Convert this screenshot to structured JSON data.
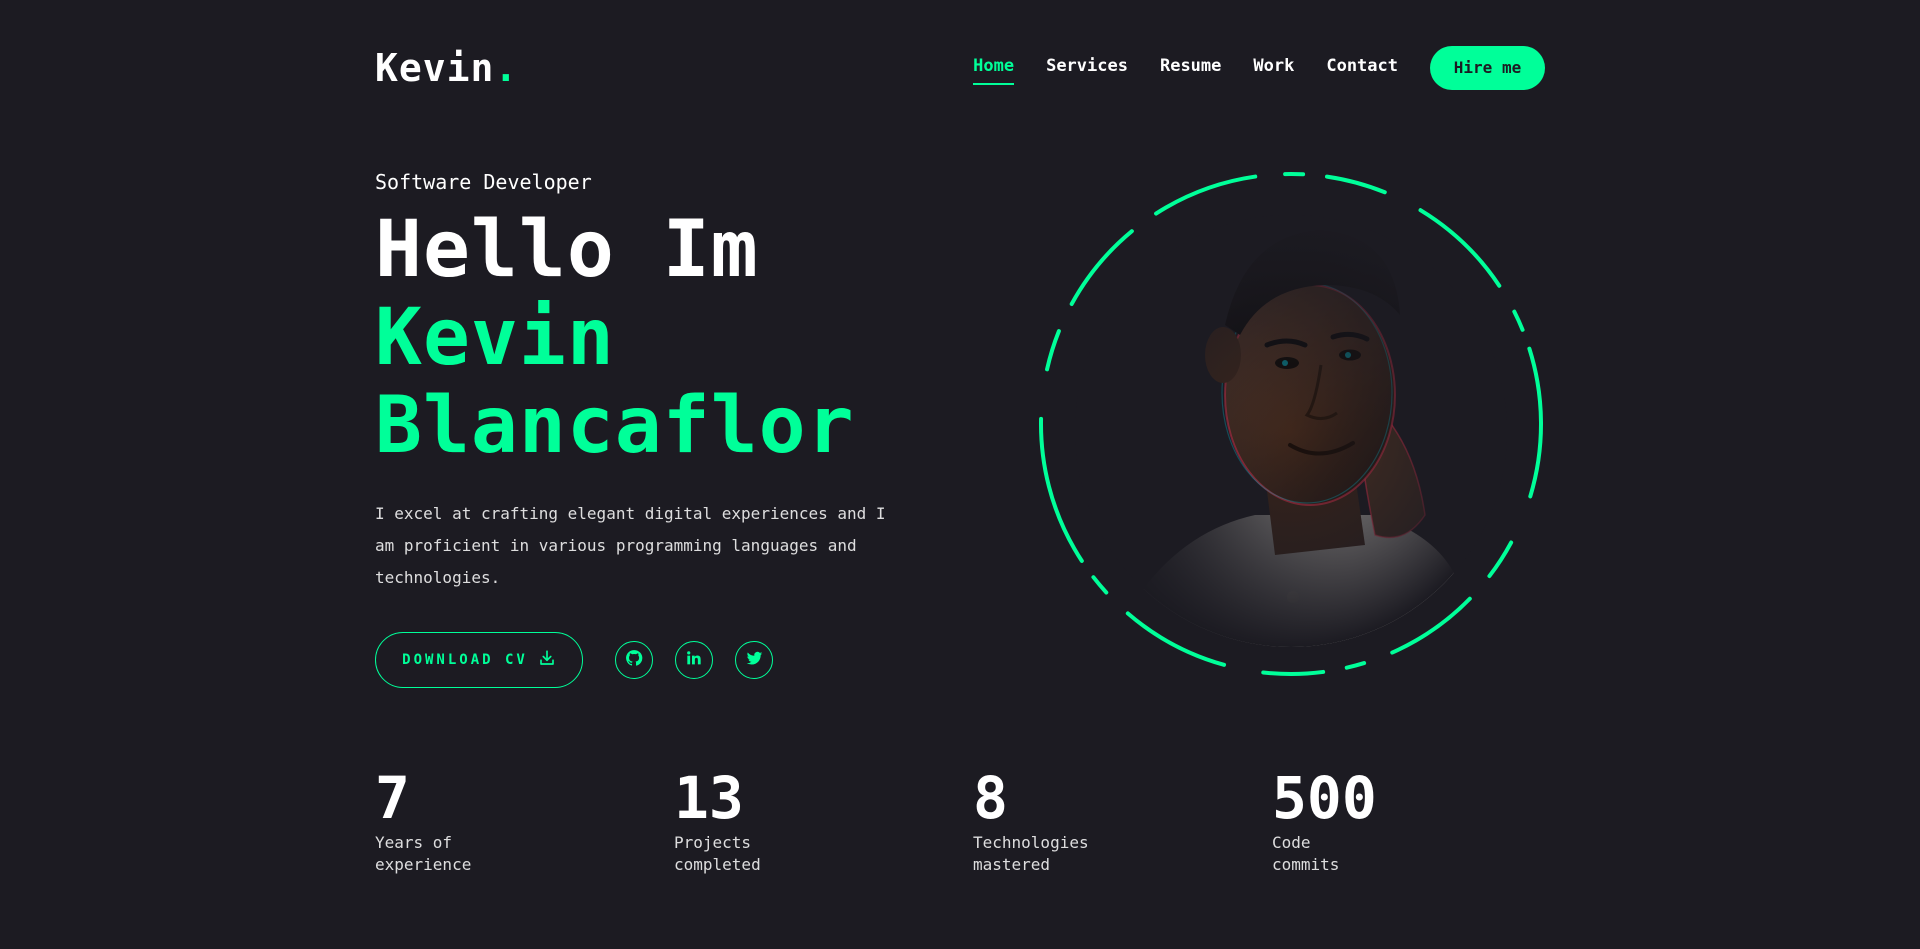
{
  "header": {
    "logo_text": "Kevin",
    "logo_dot": ".",
    "nav": [
      {
        "label": "Home",
        "active": true
      },
      {
        "label": "Services",
        "active": false
      },
      {
        "label": "Resume",
        "active": false
      },
      {
        "label": "Work",
        "active": false
      },
      {
        "label": "Contact",
        "active": false
      }
    ],
    "hire_label": "Hire me"
  },
  "hero": {
    "role": "Software Developer",
    "headline_line1": "Hello Im",
    "headline_line2": "Kevin",
    "headline_line3": "Blancaflor",
    "intro": "I excel at crafting elegant digital experiences and I am proficient in various programming languages and technologies.",
    "cv_label": "DOWNLOAD CV",
    "socials": [
      {
        "icon": "github-icon"
      },
      {
        "icon": "linkedin-icon"
      },
      {
        "icon": "twitter-icon"
      }
    ]
  },
  "stats": [
    {
      "value": "7",
      "label": "Years of\nexperience"
    },
    {
      "value": "13",
      "label": "Projects\ncompleted"
    },
    {
      "value": "8",
      "label": "Technologies\nmastered"
    },
    {
      "value": "500",
      "label": "Code\ncommits"
    }
  ],
  "colors": {
    "background": "#1c1b22",
    "accent": "#00ff99",
    "text": "#ffffff"
  }
}
